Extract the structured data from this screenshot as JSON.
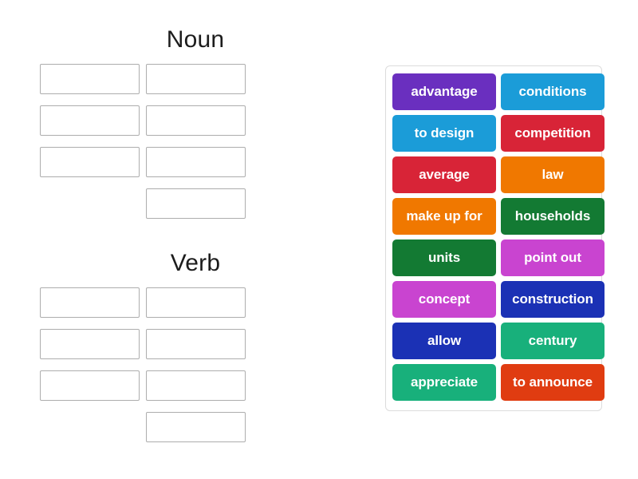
{
  "groups": [
    {
      "title": "Noun",
      "slot_count": 7,
      "slots": [
        "",
        "",
        "",
        "",
        "",
        "",
        ""
      ]
    },
    {
      "title": "Verb",
      "slot_count": 7,
      "slots": [
        "",
        "",
        "",
        "",
        "",
        "",
        ""
      ]
    }
  ],
  "tile_panel": {
    "tiles": [
      {
        "label": "advantage",
        "color": "#6A2FBF"
      },
      {
        "label": "conditions",
        "color": "#1B9CD8"
      },
      {
        "label": "to design",
        "color": "#1B9CD8"
      },
      {
        "label": "competition",
        "color": "#D82437"
      },
      {
        "label": "average",
        "color": "#D82437"
      },
      {
        "label": "law",
        "color": "#F07800"
      },
      {
        "label": "make up for",
        "color": "#F07800"
      },
      {
        "label": "households",
        "color": "#137A33"
      },
      {
        "label": "units",
        "color": "#137A33"
      },
      {
        "label": "point out",
        "color": "#C944D0"
      },
      {
        "label": "concept",
        "color": "#C944D0"
      },
      {
        "label": "construction",
        "color": "#1B31B5"
      },
      {
        "label": "allow",
        "color": "#1B31B5"
      },
      {
        "label": "century",
        "color": "#18B07B"
      },
      {
        "label": "appreciate",
        "color": "#18B07B"
      },
      {
        "label": "to announce",
        "color": "#E03C11"
      }
    ]
  },
  "colors": {
    "page_background": "#FFFFFF",
    "slot_border": "#ADADAD",
    "panel_border": "#DCDCDC",
    "title_text": "#1C1C1C",
    "tile_text": "#FFFFFF"
  }
}
